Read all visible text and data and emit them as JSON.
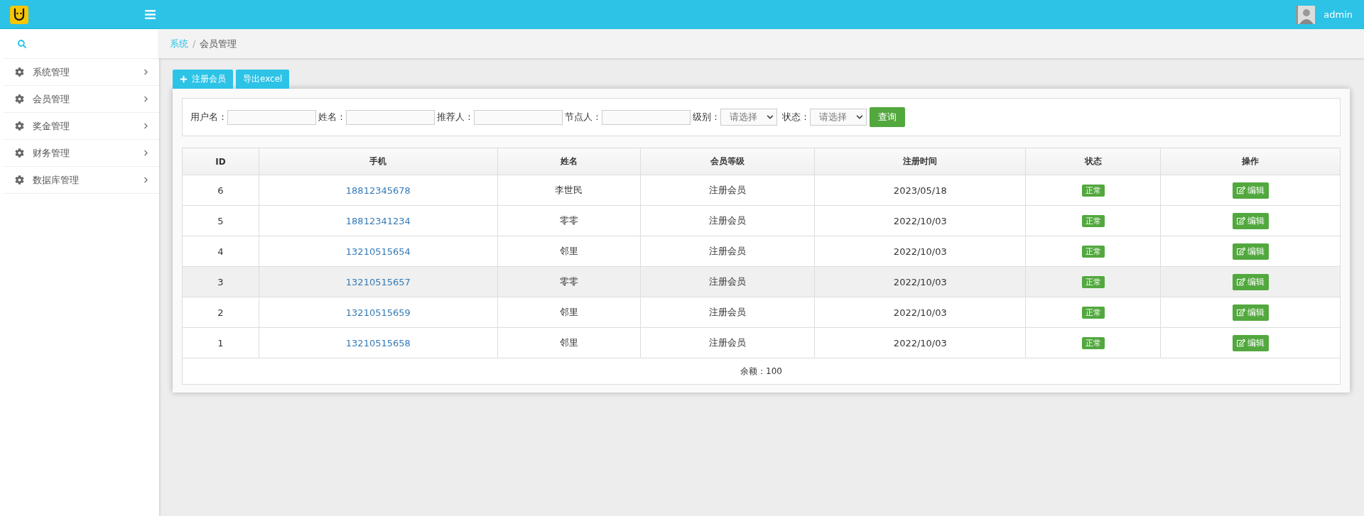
{
  "header": {
    "user": "admin"
  },
  "sidebar": {
    "items": [
      {
        "label": "系统管理"
      },
      {
        "label": "会员管理"
      },
      {
        "label": "奖金管理"
      },
      {
        "label": "财务管理"
      },
      {
        "label": "数据库管理"
      }
    ]
  },
  "breadcrumb": {
    "separator": "/",
    "items": [
      {
        "label": "系统",
        "link": true
      },
      {
        "label": "会员管理",
        "link": false
      }
    ]
  },
  "toolbar": {
    "buttons": [
      {
        "label": "注册会员",
        "kind": "add"
      },
      {
        "label": "导出excel",
        "kind": "plain"
      }
    ]
  },
  "filters": {
    "fields": [
      {
        "label": "用户名：",
        "kind": "text"
      },
      {
        "label": "姓名：",
        "kind": "text"
      },
      {
        "label": "推荐人：",
        "kind": "text"
      },
      {
        "label": "节点人：",
        "kind": "text"
      },
      {
        "label": "级别：",
        "kind": "select",
        "value": "请选择"
      },
      {
        "label": "状态：",
        "kind": "select",
        "value": "请选择"
      }
    ],
    "submit": "查询"
  },
  "table": {
    "columns": [
      "ID",
      "手机",
      "姓名",
      "会员等级",
      "注册时间",
      "状态",
      "操作"
    ],
    "rows": [
      {
        "id": "6",
        "phone": "18812345678",
        "name": "李世民",
        "level": "注册会员",
        "date": "2023/05/18",
        "status": "正常",
        "action": "编辑",
        "highlighted": false
      },
      {
        "id": "5",
        "phone": "18812341234",
        "name": "零零",
        "level": "注册会员",
        "date": "2022/10/03",
        "status": "正常",
        "action": "编辑",
        "highlighted": false
      },
      {
        "id": "4",
        "phone": "13210515654",
        "name": "邻里",
        "level": "注册会员",
        "date": "2022/10/03",
        "status": "正常",
        "action": "编辑",
        "highlighted": false
      },
      {
        "id": "3",
        "phone": "13210515657",
        "name": "零零",
        "level": "注册会员",
        "date": "2022/10/03",
        "status": "正常",
        "action": "编辑",
        "highlighted": true
      },
      {
        "id": "2",
        "phone": "13210515659",
        "name": "邻里",
        "level": "注册会员",
        "date": "2022/10/03",
        "status": "正常",
        "action": "编辑",
        "highlighted": false
      },
      {
        "id": "1",
        "phone": "13210515658",
        "name": "邻里",
        "level": "注册会员",
        "date": "2022/10/03",
        "status": "正常",
        "action": "编辑",
        "highlighted": false
      }
    ],
    "footer": "余额：100"
  }
}
